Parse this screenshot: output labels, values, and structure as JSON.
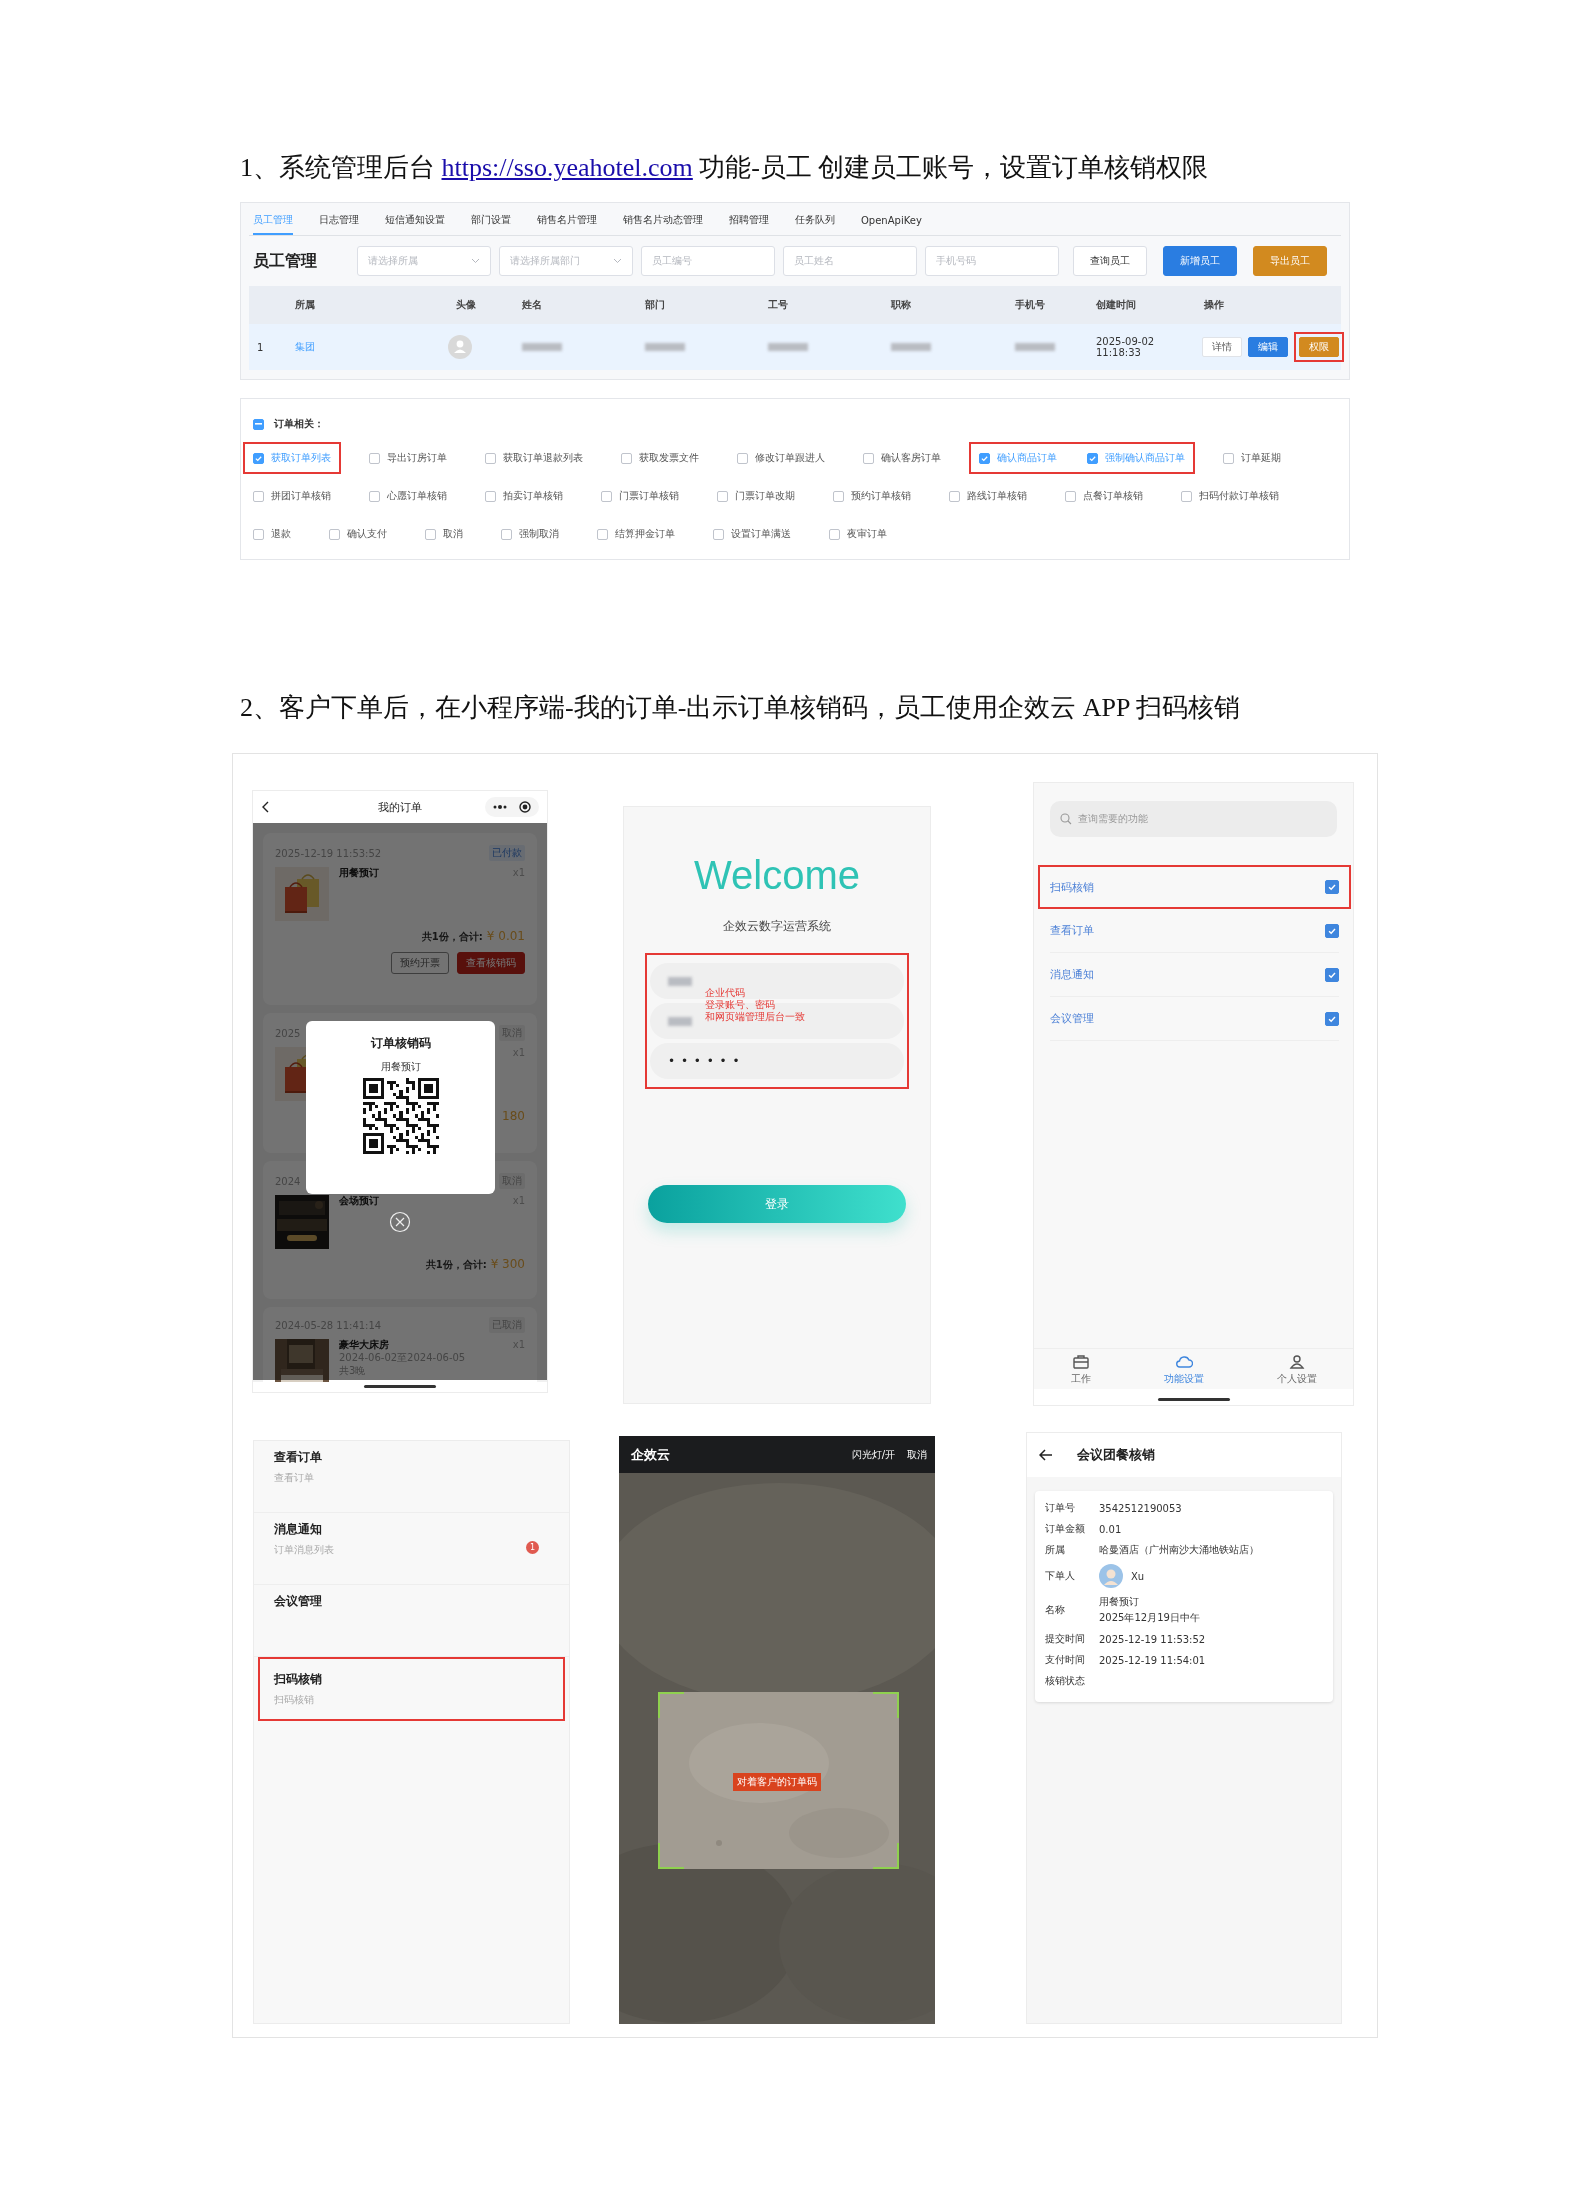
{
  "heading_1": {
    "prefix": "1、系统管理后台 ",
    "link": "https://sso.yeahotel.com",
    "suffix": " 功能-员工  创建员工账号，设置订单核销权限"
  },
  "admin": {
    "tabs": [
      {
        "label": "员工管理",
        "selected": true
      },
      {
        "label": "日志管理",
        "selected": false
      },
      {
        "label": "短信通知设置",
        "selected": false
      },
      {
        "label": "部门设置",
        "selected": false
      },
      {
        "label": "销售名片管理",
        "selected": false
      },
      {
        "label": "销售名片动态管理",
        "selected": false
      },
      {
        "label": "招聘管理",
        "selected": false
      },
      {
        "label": "任务队列",
        "selected": false
      },
      {
        "label": "OpenApiKey",
        "selected": false
      }
    ],
    "title": "员工管理",
    "filters": [
      {
        "kind": "select",
        "placeholder": "请选择所属"
      },
      {
        "kind": "select",
        "placeholder": "请选择所属部门"
      },
      {
        "kind": "input",
        "placeholder": "员工编号"
      },
      {
        "kind": "input",
        "placeholder": "员工姓名"
      },
      {
        "kind": "input",
        "placeholder": "手机号码"
      }
    ],
    "buttons": [
      {
        "label": "查询员工"
      },
      {
        "label": "新增员工"
      },
      {
        "label": "导出员工"
      }
    ],
    "table": {
      "columns": [
        "",
        "所属",
        "头像",
        "姓名",
        "部门",
        "工号",
        "职称",
        "手机号",
        "创建时间",
        "操作"
      ],
      "rows": [
        {
          "cells": [
            {
              "kind": "text",
              "text": "1"
            },
            {
              "kind": "link",
              "text": "集团"
            },
            {
              "kind": "avatar"
            },
            {
              "kind": "redacted"
            },
            {
              "kind": "redacted"
            },
            {
              "kind": "redacted"
            },
            {
              "kind": "redacted"
            },
            {
              "kind": "redacted"
            },
            {
              "kind": "text",
              "text": "2025-09-02 11:18:33"
            },
            {
              "kind": "actions",
              "buttons": [
                {
                  "label": "详情",
                  "highlighted": false
                },
                {
                  "label": "编辑",
                  "highlighted": false
                },
                {
                  "label": "权限",
                  "highlighted": true
                }
              ]
            }
          ]
        }
      ]
    }
  },
  "permissions": {
    "group": {
      "label": "订单相关：",
      "indeterminate": true
    },
    "rows": [
      {
        "items": [
          {
            "label": "获取订单列表",
            "checked": true,
            "highlighted": true
          },
          {
            "label": "导出订房订单",
            "checked": false,
            "highlighted": false
          },
          {
            "label": "获取订单退款列表",
            "checked": false,
            "highlighted": false
          },
          {
            "label": "获取发票文件",
            "checked": false,
            "highlighted": false
          },
          {
            "label": "修改订单跟进人",
            "checked": false,
            "highlighted": false
          },
          {
            "label": "确认客房订单",
            "checked": false,
            "highlighted": false
          },
          {
            "label": "确认商品订单",
            "checked": true,
            "highlighted": true
          },
          {
            "label": "强制确认商品订单",
            "checked": true,
            "highlighted": true
          },
          {
            "label": "订单延期",
            "checked": false,
            "highlighted": false
          }
        ]
      },
      {
        "items": [
          {
            "label": "拼团订单核销",
            "checked": false,
            "highlighted": false
          },
          {
            "label": "心愿订单核销",
            "checked": false,
            "highlighted": false
          },
          {
            "label": "拍卖订单核销",
            "checked": false,
            "highlighted": false
          },
          {
            "label": "门票订单核销",
            "checked": false,
            "highlighted": false
          },
          {
            "label": "门票订单改期",
            "checked": false,
            "highlighted": false
          },
          {
            "label": "预约订单核销",
            "checked": false,
            "highlighted": false
          },
          {
            "label": "路线订单核销",
            "checked": false,
            "highlighted": false
          },
          {
            "label": "点餐订单核销",
            "checked": false,
            "highlighted": false
          },
          {
            "label": "扫码付款订单核销",
            "checked": false,
            "highlighted": false
          }
        ]
      },
      {
        "items": [
          {
            "label": "退款",
            "checked": false,
            "highlighted": false
          },
          {
            "label": "确认支付",
            "checked": false,
            "highlighted": false
          },
          {
            "label": "取消",
            "checked": false,
            "highlighted": false
          },
          {
            "label": "强制取消",
            "checked": false,
            "highlighted": false
          },
          {
            "label": "结算押金订单",
            "checked": false,
            "highlighted": false
          },
          {
            "label": "设置订单满送",
            "checked": false,
            "highlighted": false
          },
          {
            "label": "夜审订单",
            "checked": false,
            "highlighted": false
          }
        ]
      }
    ]
  },
  "heading_2": "2、客户下单后，在小程序端-我的订单-出示订单核销码，员工使用企效云 APP 扫码核销",
  "orders_screen": {
    "title": "我的订单",
    "orders": [
      {
        "date": "2025-12-19 11:53:52",
        "status": "已付款",
        "kind": "paid",
        "item": "用餐预订",
        "qty": "x1",
        "total_label": "共1份，合计:",
        "total": "¥ 0.01",
        "buttons": [
          {
            "label": "预约开票"
          },
          {
            "label": "查看核销码"
          }
        ]
      },
      {
        "date": "2025",
        "status": "取消",
        "kind": "cancelled",
        "qty": "x1",
        "total": "180"
      },
      {
        "date": "2024",
        "status": "取消",
        "kind": "cancelled",
        "item": "会场预订",
        "qty": "x1",
        "total_label": "共1份，合计:",
        "total": "¥ 300"
      },
      {
        "date": "2024-05-28 11:41:14",
        "status": "已取消",
        "kind": "cancelled",
        "item": "豪华大床房",
        "qty": "x1",
        "details": [
          "2024-06-02至2024-06-05",
          "共3晚"
        ]
      }
    ],
    "dialog": {
      "title": "订单核销码",
      "subtitle": "用餐预订"
    }
  },
  "login_screen": {
    "welcome": "Welcome",
    "subtitle": "企效云数字运营系统",
    "fields": [
      {
        "kind": "redacted"
      },
      {
        "kind": "redacted"
      },
      {
        "kind": "password",
        "value": "• • • • • •"
      }
    ],
    "note": [
      "企业代码",
      "登录账号、密码",
      "和网页端管理后台一致"
    ],
    "button": "登录"
  },
  "features_screen": {
    "search_placeholder": "查询需要的功能",
    "items": [
      {
        "label": "扫码核销",
        "checked": true,
        "highlighted": true
      },
      {
        "label": "查看订单",
        "checked": true,
        "highlighted": false
      },
      {
        "label": "消息通知",
        "checked": true,
        "highlighted": false
      },
      {
        "label": "会议管理",
        "checked": true,
        "highlighted": false
      }
    ],
    "nav": [
      {
        "label": "工作",
        "selected": false
      },
      {
        "label": "功能设置",
        "selected": true
      },
      {
        "label": "个人设置",
        "selected": false
      }
    ]
  },
  "menu_screen": {
    "items": [
      {
        "title": "查看订单",
        "subtitle": "查看订单",
        "highlighted": false
      },
      {
        "title": "消息通知",
        "subtitle": "订单消息列表",
        "badge": "1",
        "highlighted": false
      },
      {
        "title": "会议管理",
        "highlighted": false
      },
      {
        "title": "扫码核销",
        "subtitle": "扫码核销",
        "highlighted": true
      }
    ]
  },
  "scan_screen": {
    "title": "企效云",
    "actions": [
      "闪光灯/开",
      "取消"
    ],
    "hint": "对着客户的订单码"
  },
  "detail_screen": {
    "title": "会议团餐核销",
    "fields": [
      {
        "label": "订单号",
        "kind": "text",
        "value": [
          "3542512190053"
        ]
      },
      {
        "label": "订单金额",
        "kind": "text",
        "value": [
          "0.01"
        ]
      },
      {
        "label": "所属",
        "kind": "text",
        "value": [
          "哈曼酒店（广州南沙大涌地铁站店）"
        ]
      },
      {
        "label": "下单人",
        "kind": "user",
        "value": [
          "Xu"
        ]
      },
      {
        "label": "名称",
        "kind": "text",
        "value": [
          "用餐预订",
          "2025年12月19日中午"
        ]
      },
      {
        "label": "提交时间",
        "kind": "text",
        "value": [
          "2025-12-19 11:53:52"
        ]
      },
      {
        "label": "支付时间",
        "kind": "text",
        "value": [
          "2025-12-19 11:54:01"
        ]
      },
      {
        "label": "核销状态",
        "kind": "text"
      }
    ]
  }
}
